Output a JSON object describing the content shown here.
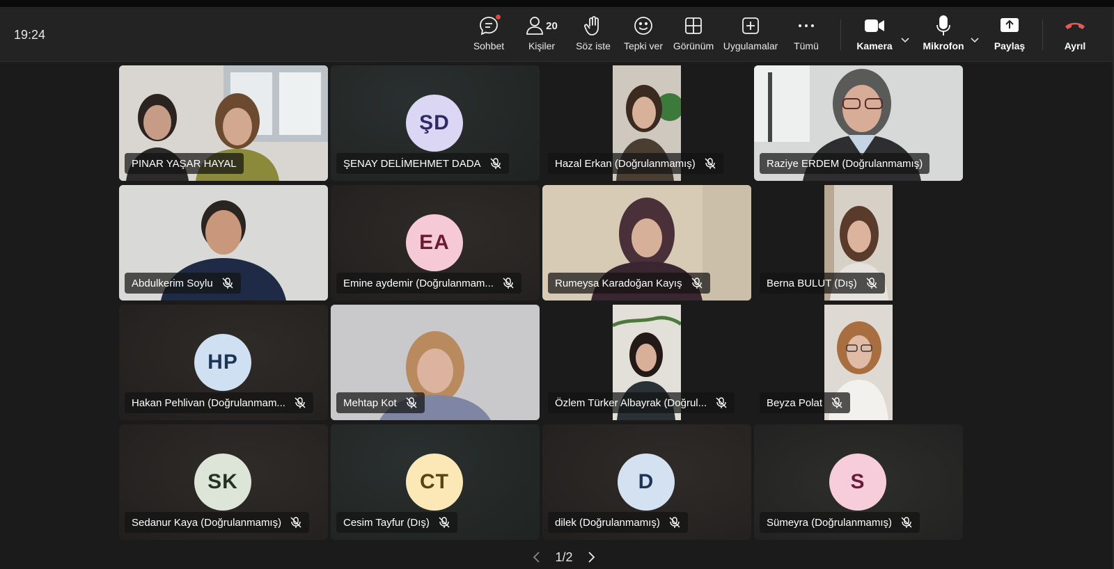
{
  "time": "19:24",
  "toolbar": {
    "chat_label": "Sohbet",
    "people_label": "Kişiler",
    "people_count": "20",
    "raise_label": "Söz iste",
    "react_label": "Tepki ver",
    "view_label": "Görünüm",
    "apps_label": "Uygulamalar",
    "more_label": "Tümü",
    "camera_label": "Kamera",
    "mic_label": "Mikrofon",
    "share_label": "Paylaş",
    "leave_label": "Ayrıl",
    "leave_color": "#e25b5b"
  },
  "participants": [
    {
      "name": "PINAR YAŞAR HAYAL"
    },
    {
      "name": "ŞENAY DELİMEHMET DADA",
      "initials": "ŞD",
      "avatar_bg": "#dcd6f5",
      "avatar_fg": "#2e2a66"
    },
    {
      "name": "Hazal Erkan (Doğrulanmamış)"
    },
    {
      "name": "Raziye ERDEM (Doğrulanmamış)"
    },
    {
      "name": "Abdulkerim Soylu"
    },
    {
      "name": "Emine aydemir (Doğrulanmam...",
      "initials": "EA",
      "avatar_bg": "#f6c9d6",
      "avatar_fg": "#6b1a35"
    },
    {
      "name": "Rumeysa Karadoğan Kayış"
    },
    {
      "name": "Berna BULUT (Dış)"
    },
    {
      "name": "Hakan Pehlivan (Doğrulanmam...",
      "initials": "HP",
      "avatar_bg": "#cfe0f3",
      "avatar_fg": "#1c3557"
    },
    {
      "name": "Mehtap Kot"
    },
    {
      "name": "Özlem Türker Albayrak (Doğrul..."
    },
    {
      "name": "Beyza Polat"
    },
    {
      "name": "Sedanur Kaya (Doğrulanmamış)",
      "initials": "SK",
      "avatar_bg": "#dde4d8",
      "avatar_fg": "#24331f"
    },
    {
      "name": "Cesim Tayfur (Dış)",
      "initials": "CT",
      "avatar_bg": "#fbe8b6",
      "avatar_fg": "#5a4211"
    },
    {
      "name": "dilek (Doğrulanmamış)",
      "initials": "D",
      "avatar_bg": "#d3e1f1",
      "avatar_fg": "#1e3656"
    },
    {
      "name": "Sümeyra (Doğrulanmamış)",
      "initials": "S",
      "avatar_bg": "#f7cddb",
      "avatar_fg": "#6a1b3a"
    }
  ],
  "pager": {
    "label": "1/2"
  }
}
